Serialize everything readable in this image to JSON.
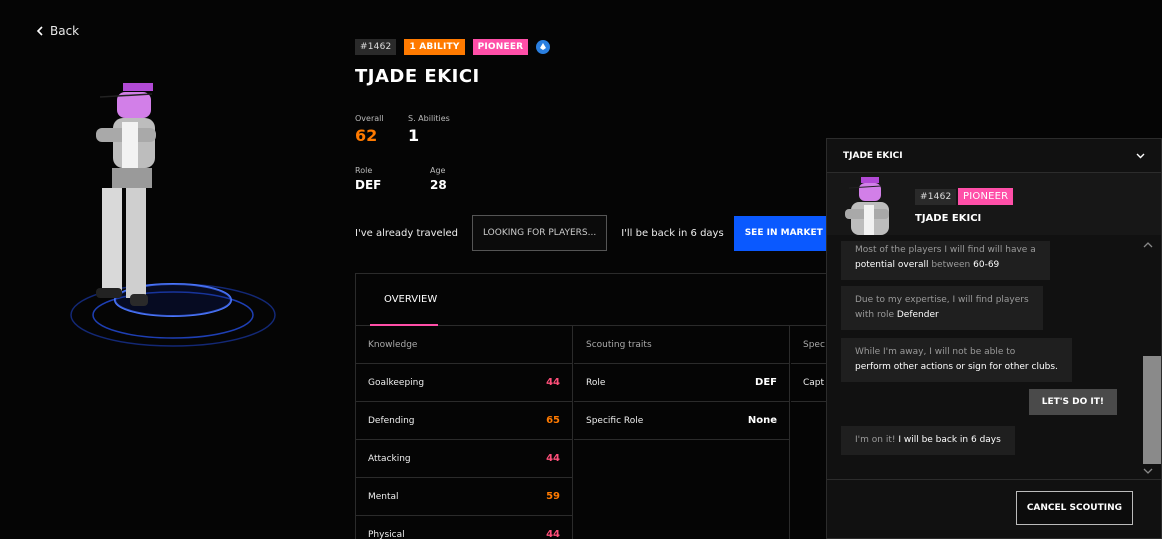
{
  "nav": {
    "back_label": "Back"
  },
  "player": {
    "id_tag": "#1462",
    "ability_badge": "1 ABILITY",
    "pioneer_badge": "PIONEER",
    "name": "TJADE EKICI",
    "stats": {
      "overall_label": "Overall",
      "overall_value": "62",
      "abilities_label": "S. Abilities",
      "abilities_value": "1",
      "role_label": "Role",
      "role_value": "DEF",
      "age_label": "Age",
      "age_value": "28"
    }
  },
  "travel": {
    "status_text": "I've already traveled",
    "looking_label": "LOOKING FOR PLAYERS...",
    "back_text": "I'll be back in 6 days",
    "market_button": "SEE IN MARKET"
  },
  "panel": {
    "tab_overview": "OVERVIEW",
    "knowledge_header": "Knowledge",
    "knowledge": [
      {
        "label": "Goalkeeping",
        "value": "44"
      },
      {
        "label": "Defending",
        "value": "65"
      },
      {
        "label": "Attacking",
        "value": "44"
      },
      {
        "label": "Mental",
        "value": "59"
      },
      {
        "label": "Physical",
        "value": "44"
      }
    ],
    "traits_header": "Scouting traits",
    "traits": [
      {
        "label": "Role",
        "value": "DEF"
      },
      {
        "label": "Specific Role",
        "value": "None"
      }
    ],
    "third_header": "Spec",
    "third_row": "Capt"
  },
  "chat": {
    "header_name": "TJADE EKICI",
    "profile_id": "#1462",
    "profile_badge": "PIONEER",
    "profile_name": "TJADE EKICI",
    "msg1_a": "Most of the players I will find will have a",
    "msg1_b": "potential overall",
    "msg1_c": " between ",
    "msg1_d": "60-69",
    "msg2_a": "Due to my expertise, I will find players",
    "msg2_b": "with role ",
    "msg2_c": "Defender",
    "msg3_a": "While I'm away, I will not be able to",
    "msg3_b": "perform other actions or sign for other clubs.",
    "lets_button": "LET'S DO IT!",
    "msg4_a": "I'm on it! ",
    "msg4_b": "I will be back in 6 days",
    "cancel_button": "CANCEL SCOUTING"
  },
  "colors": {
    "orange": "#ff7a00",
    "pink": "#ff4fa8",
    "blue": "#0a59ff"
  }
}
